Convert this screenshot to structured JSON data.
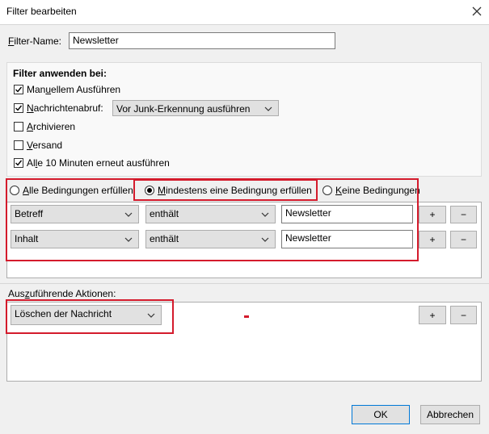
{
  "window": {
    "title": "Filter bearbeiten"
  },
  "filter_name": {
    "label_pre": "F",
    "label_rest": "ilter-Name:",
    "value": "Newsletter"
  },
  "apply": {
    "heading": "Filter anwenden bei:",
    "items": [
      {
        "pre": "Man",
        "u": "u",
        "post": "ellem Ausführen",
        "checked": true
      },
      {
        "pre": "",
        "u": "N",
        "post": "achrichtenabruf:",
        "checked": true
      },
      {
        "pre": "",
        "u": "A",
        "post": "rchivieren",
        "checked": false
      },
      {
        "pre": "",
        "u": "V",
        "post": "ersand",
        "checked": false
      },
      {
        "pre": "Al",
        "u": "l",
        "post": "e 10 Minuten erneut ausführen",
        "checked": true
      }
    ],
    "junk_select": "Vor Junk-Erkennung ausführen"
  },
  "match": {
    "all": {
      "pre": "",
      "u": "A",
      "post": "lle Bedingungen erfüllen"
    },
    "any": {
      "pre": "",
      "u": "M",
      "post": "indestens eine Bedingung erfüllen"
    },
    "none": {
      "pre": "",
      "u": "K",
      "post": "eine Bedingungen"
    }
  },
  "rules": [
    {
      "field": "Betreff",
      "op": "enthält",
      "value": "Newsletter"
    },
    {
      "field": "Inhalt",
      "op": "enthält",
      "value": "Newsletter"
    }
  ],
  "actions": {
    "label_pre": "Aus",
    "label_u": "z",
    "label_post": "uführende Aktionen:",
    "action": "Löschen der Nachricht"
  },
  "buttons": {
    "add": "+",
    "remove": "−",
    "ok": "OK",
    "cancel": "Abbrechen"
  },
  "colors": {
    "highlight": "#d41b2c",
    "accent": "#0078d7"
  }
}
